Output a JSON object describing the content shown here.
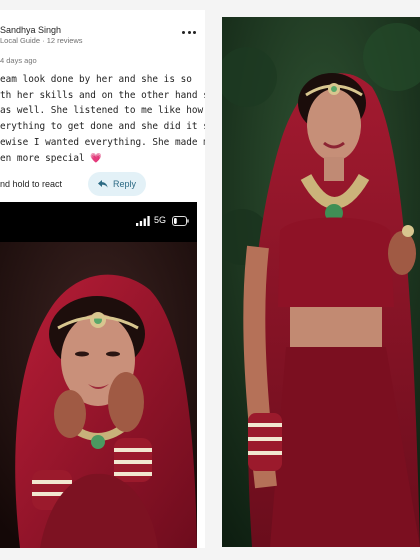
{
  "review": {
    "reviewer_name": "Sandhya Singh",
    "reviewer_meta": "Local Guide · 12 reviews",
    "date": "4 days ago",
    "text_lines": [
      "eam look done by her and she is so",
      "th her skills and on the other hand she is",
      "as well. She listened to me like how I",
      "erything to get done and she did it so well",
      "ewise I wanted everything. She made my",
      "en more special 💗"
    ],
    "hint": "nd hold to react",
    "reply_label": "Reply"
  },
  "phone_status": {
    "network": "5G",
    "battery_level": 0.25
  },
  "icons": {
    "more": "more-horizontal-icon",
    "reply": "reply-arrow-icon",
    "signal": "signal-bars-icon",
    "battery": "battery-icon"
  },
  "colors": {
    "reply_bg": "#e3f1f7",
    "reply_fg": "#2c6a84",
    "lehenga_red": "#8e1226",
    "dupatta_red": "#a3172c",
    "foliage_green": "#1d3a22"
  }
}
